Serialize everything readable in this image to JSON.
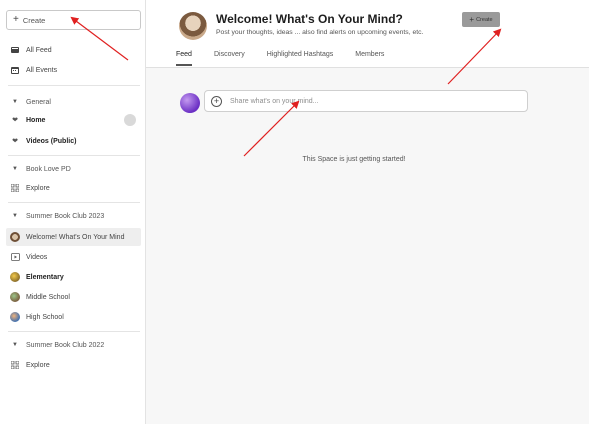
{
  "sidebar": {
    "create_label": "Create",
    "top_items": [
      {
        "label": "All Feed",
        "icon": "feed-icon"
      },
      {
        "label": "All Events",
        "icon": "calendar-icon"
      }
    ],
    "groups": [
      {
        "name": "General",
        "items": [
          "Home",
          "Videos (Public)"
        ]
      },
      {
        "name": "Book Love PD",
        "items": [
          "Explore"
        ]
      },
      {
        "name": "Summer Book Club 2023",
        "items": [
          "Welcome! What's On Your Mind",
          "Videos",
          "Elementary",
          "Middle School",
          "High School"
        ]
      },
      {
        "name": "Summer Book Club 2022",
        "items": [
          "Explore"
        ]
      }
    ]
  },
  "header": {
    "title": "Welcome! What's On Your Mind?",
    "description": "Post your thoughts, ideas ... also find alerts on upcoming events, etc.",
    "create_label": "Create",
    "tabs": [
      "Feed",
      "Discovery",
      "Highlighted Hashtags",
      "Members"
    ],
    "active_tab": "Feed"
  },
  "main": {
    "post_placeholder": "Share what's on your mind...",
    "empty_message": "This Space is just getting started!"
  },
  "colors": {
    "arrow": "#e02020",
    "heart": "#e36a8a",
    "create_button_bg": "#9a9a9a"
  }
}
